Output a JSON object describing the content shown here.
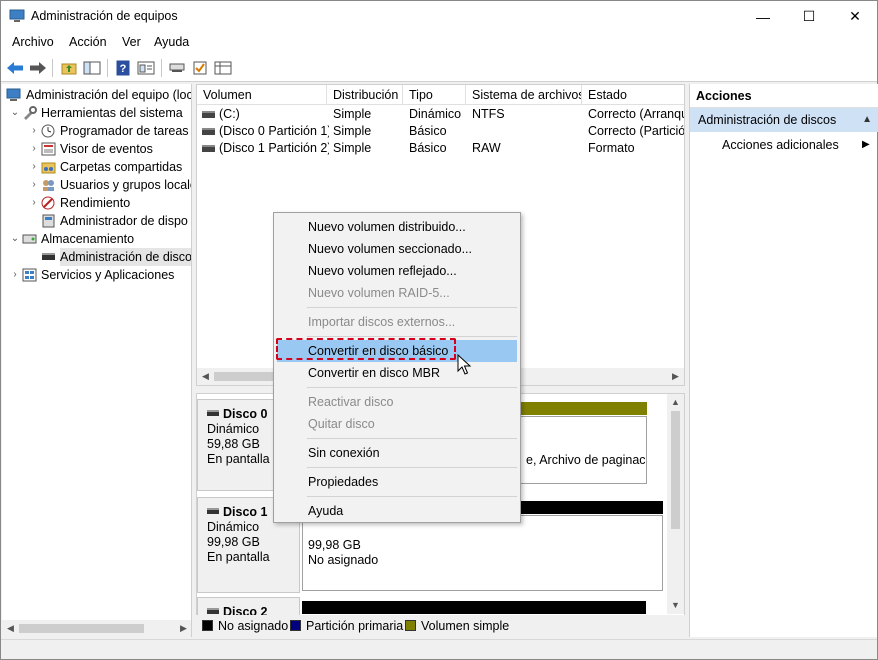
{
  "window": {
    "title": "Administración de equipos",
    "close_glyph": "✕",
    "max_glyph": "☐",
    "min_glyph": "—"
  },
  "menu": [
    "Archivo",
    "Acción",
    "Ver",
    "Ayuda"
  ],
  "toolbar": {
    "icons": [
      "back-arrow-icon",
      "forward-arrow-icon",
      "up-folder-icon",
      "show-hide-tree-icon",
      "help-icon",
      "properties-icon",
      "connect-icon",
      "check-icon",
      "grid-icon"
    ]
  },
  "tree": {
    "root": "Administración del equipo (loc",
    "items": [
      {
        "label": "Herramientas del sistema",
        "level": 1,
        "expander": "⌄"
      },
      {
        "label": "Programador de tareas",
        "level": 2,
        "expander": "›"
      },
      {
        "label": "Visor de eventos",
        "level": 2,
        "expander": "›"
      },
      {
        "label": "Carpetas compartidas",
        "level": 2,
        "expander": "›"
      },
      {
        "label": "Usuarios y grupos locale",
        "level": 2,
        "expander": "›"
      },
      {
        "label": "Rendimiento",
        "level": 2,
        "expander": "›"
      },
      {
        "label": "Administrador de dispo",
        "level": 2,
        "expander": ""
      },
      {
        "label": "Almacenamiento",
        "level": 1,
        "expander": "⌄"
      },
      {
        "label": "Administración de disco",
        "level": 2,
        "expander": ""
      },
      {
        "label": "Servicios y Aplicaciones",
        "level": 1,
        "expander": "›"
      }
    ]
  },
  "volumes": {
    "columns": [
      "Volumen",
      "Distribución",
      "Tipo",
      "Sistema de archivos",
      "Estado"
    ],
    "rows": [
      [
        "(C:)",
        "Simple",
        "Dinámico",
        "NTFS",
        "Correcto (Arranqu"
      ],
      [
        "(Disco 0 Partición 1)",
        "Simple",
        "Básico",
        "",
        "Correcto (Partición"
      ],
      [
        "(Disco 1 Partición 2)",
        "Simple",
        "Básico",
        "RAW",
        "Formato"
      ]
    ]
  },
  "disks": [
    {
      "name": "Disco 0",
      "type": "Dinámico",
      "size": "59,88 GB",
      "status": "En pantalla",
      "partition_text": "e, Archivo de paginació",
      "bar_color": "#808000"
    },
    {
      "name": "Disco 1",
      "type": "Dinámico",
      "size": "99,98 GB",
      "status": "En pantalla",
      "partition_size": "99,98 GB",
      "partition_status": "No asignado",
      "bar_color": "#000000"
    },
    {
      "name": "Disco 2",
      "bar_color": "#000000"
    }
  ],
  "legend": [
    {
      "label": "No asignado",
      "color": "#000000"
    },
    {
      "label": "Partición primaria",
      "color": "#000080"
    },
    {
      "label": "Volumen simple",
      "color": "#808000"
    }
  ],
  "actions": {
    "title": "Acciones",
    "section": "Administración de discos",
    "more": "Acciones adicionales"
  },
  "context_menu": {
    "items": [
      {
        "label": "Nuevo volumen distribuido...",
        "disabled": false
      },
      {
        "label": "Nuevo volumen seccionado...",
        "disabled": false
      },
      {
        "label": "Nuevo volumen reflejado...",
        "disabled": false
      },
      {
        "label": "Nuevo volumen RAID-5...",
        "disabled": true
      },
      {
        "label": "Importar discos externos...",
        "disabled": true
      },
      {
        "label": "Convertir en disco básico",
        "disabled": false,
        "hover": true
      },
      {
        "label": "Convertir en disco MBR",
        "disabled": false
      },
      {
        "label": "Reactivar disco",
        "disabled": true
      },
      {
        "label": "Quitar disco",
        "disabled": true
      },
      {
        "label": "Sin conexión",
        "disabled": false
      },
      {
        "label": "Propiedades",
        "disabled": false
      },
      {
        "label": "Ayuda",
        "disabled": false
      }
    ],
    "highlight_color": "#d6001c",
    "hover_color": "#99c9f2"
  }
}
